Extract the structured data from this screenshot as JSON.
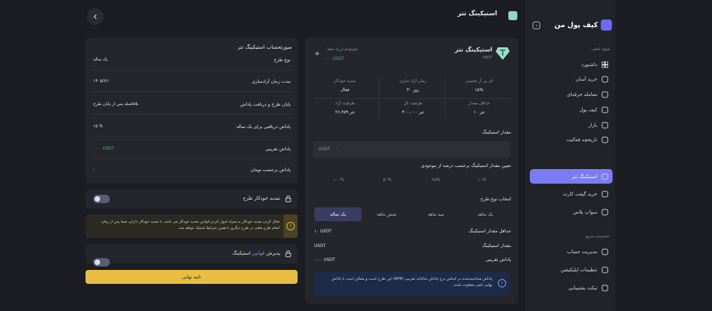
{
  "header": {
    "title": "استیکینگ تتر"
  },
  "sidebar": {
    "logo": "کیف پول من",
    "section_main": "منوی اصلی",
    "items": [
      {
        "label": "داشبورد",
        "icon": "grid-icon"
      },
      {
        "label": "خرید آسان",
        "icon": "cart-icon"
      },
      {
        "label": "معامله حرفه‌ای",
        "icon": "chart-icon"
      },
      {
        "label": "کیف پول",
        "icon": "wallet-icon"
      },
      {
        "label": "بازار",
        "icon": "market-icon"
      },
      {
        "label": "تاریخچه فعالیت",
        "icon": "history-icon"
      },
      {
        "label": "استیکینگ تتر",
        "icon": "staking-icon",
        "active": true
      },
      {
        "label": "خرید گیفت کارت",
        "icon": "gift-icon"
      },
      {
        "label": "سواپ پلاس",
        "icon": "swap-icon"
      }
    ],
    "section_quick": "دسترسی سریع",
    "quick": [
      {
        "label": "مدیریت حساب",
        "icon": "user-card-icon"
      },
      {
        "label": "تنظیمات اپلیکیشن",
        "icon": "settings-icon"
      },
      {
        "label": "تیکت پشتیبانی",
        "icon": "ticket-icon"
      }
    ]
  },
  "plan": {
    "title": "استیکینگ تتر",
    "currency": "USDT",
    "balance_label": "موجودی ارزی شما",
    "balance_value": "۰.۰۰ USDT",
    "stats": [
      {
        "label": "ای پی آر تخمینی",
        "value": "۱۵%"
      },
      {
        "label": "زمان آزاد سازی",
        "value": "۳۰ روز"
      },
      {
        "label": "تمدید خودکار",
        "value": "فعال"
      },
      {
        "label": "حداقل مقدار",
        "value": "۱۰ تتر"
      },
      {
        "label": "ظرفیت کل",
        "value": "۴۰۰,۰۰۰ تتر"
      },
      {
        "label": "ظرفیت آزاد",
        "value": "۲۶,۴۵۹ تتر"
      }
    ],
    "amount_label": "مقدار استیکینگ",
    "amount_unit": "USDT",
    "amount_value": "۰",
    "percent_label": "تعیین مقدار استیکینگ برحسب درصد از موجودی",
    "percents": [
      "۱۰%",
      "۲۵%",
      "۵۰%",
      "۱۰۰%"
    ],
    "type_label": "انتخاب نوع طرح",
    "types": [
      "یک ماهه",
      "سه ماهه",
      "شش ماهه",
      "یک ساله"
    ],
    "min_label": "حداقل مقدار استیکینگ",
    "min_value": "۱۰ USDT",
    "stake_label": "مقدار استیکینگ",
    "stake_value": "USDT",
    "reward_label": "پاداش تقریبی",
    "reward_value": "۰.۰۰ USDT",
    "info": "پاداش محاسبه‌شده بر اساس نرخ پاداش سالیانه تقریبی (APR) این طرح است و ممکن است با پاداش نهایی کمی متفاوت باشد."
  },
  "invoice": {
    "title": "صورتحساب استیکینگ تتر",
    "rows": [
      {
        "label": "نوع طرح",
        "value": "یک ساله"
      },
      {
        "label": "مدت زمان آزادسازی",
        "value": "۱۴۰۵/۶/۱"
      },
      {
        "label": "پایان طرح و دریافت پاداش",
        "value": "بلافاصله پس از پایان طرح"
      },
      {
        "label": "پاداش دریافتی برای یک ساله",
        "value": "۱۵ %"
      },
      {
        "label": "پاداش تقریبی",
        "value": "۰.۰۰ USDT"
      },
      {
        "label": "پاداش برحسب تومان",
        "value": "۰"
      }
    ],
    "auto_renew_label": "تمدید خودکار طرح",
    "warning": "فعال کردن تمدید خودکار به منزله قبول کردن قوانین تمدید خودکار می باشد. با تمدید خودکار دارایی شما پس از زمان اتمام طرح فعلی در طرح دیگری با همین شرایط استیک خواهد شد.",
    "terms_prefix": "پذیرش",
    "terms_link": "قوانین",
    "terms_suffix": "استیکینگ",
    "confirm": "تایید نهایی"
  },
  "colors": {
    "accent": "#7c7cf2",
    "confirm": "#e8bd42",
    "green": "#3fb97a"
  }
}
